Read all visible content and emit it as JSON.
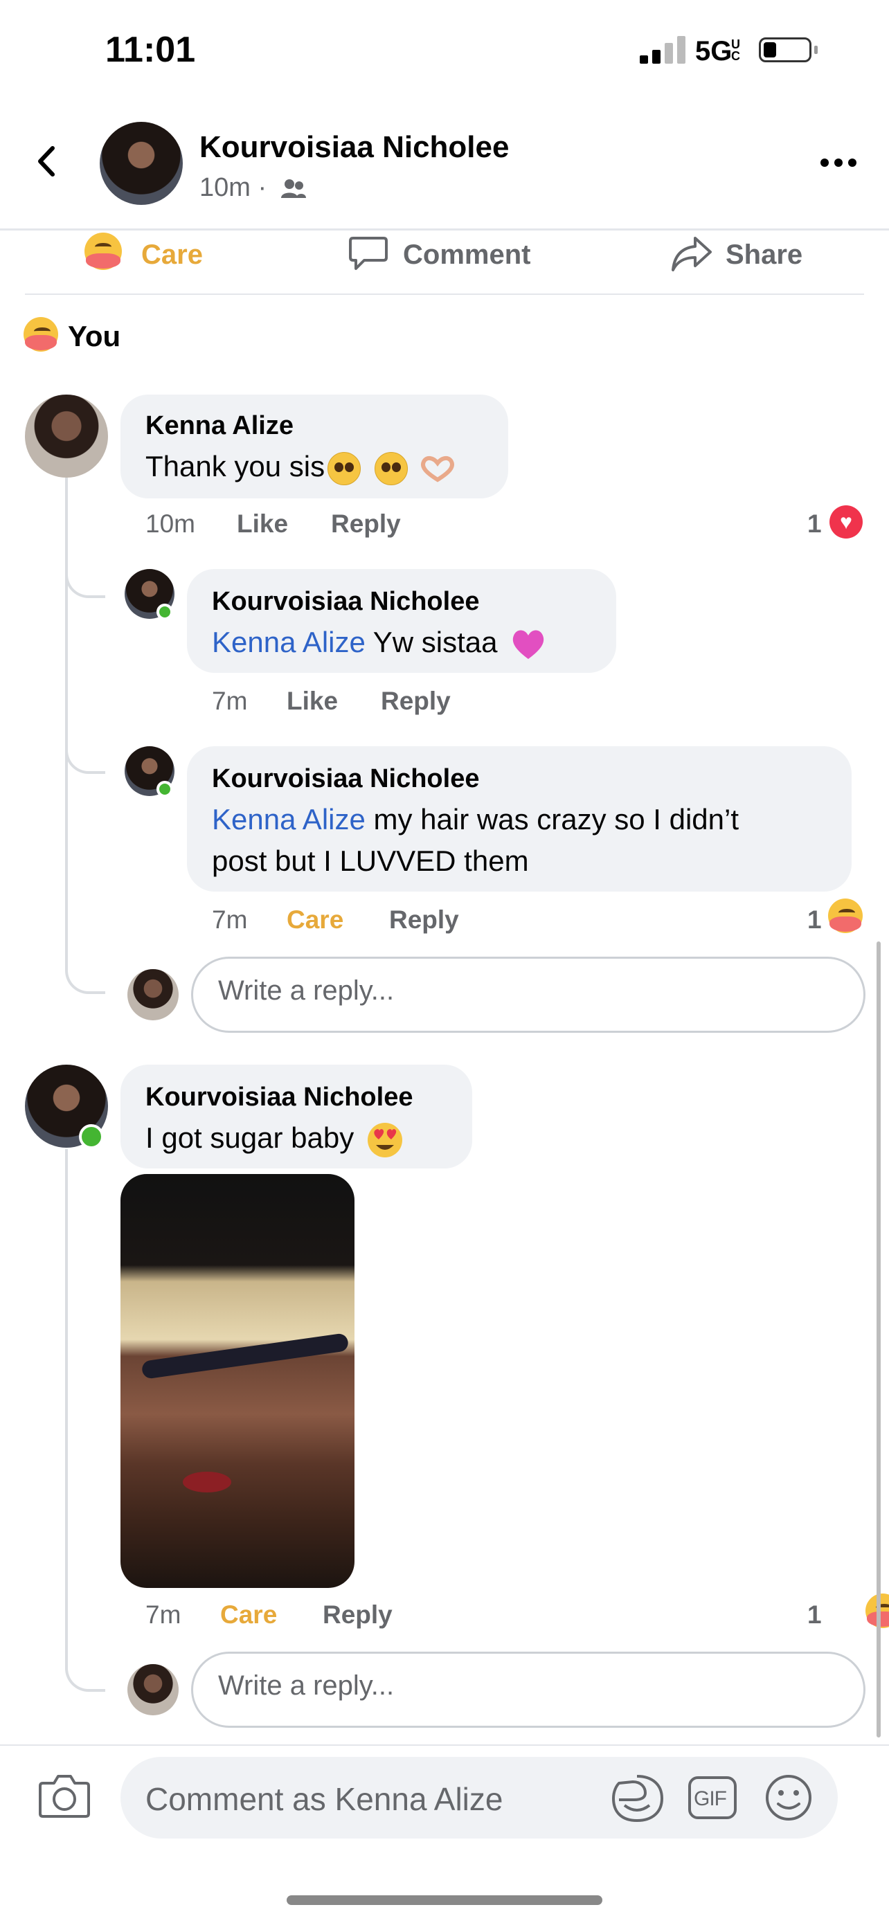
{
  "status_bar": {
    "time": "11:01",
    "network": "5G",
    "network_suffix": "UC"
  },
  "header": {
    "name": "Kourvoisiaa Nicholee",
    "time": "10m ·"
  },
  "actions": {
    "care": "Care",
    "comment": "Comment",
    "share": "Share"
  },
  "reactions": {
    "label": "You"
  },
  "comments": [
    {
      "author": "Kenna Alize",
      "text": "Thank you sis",
      "time": "10m",
      "like": "Like",
      "reply": "Reply",
      "count": "1",
      "replies": [
        {
          "author": "Kourvoisiaa Nicholee",
          "mention": "Kenna Alize",
          "text": "Yw sistaa",
          "time": "7m",
          "like": "Like",
          "reply": "Reply"
        },
        {
          "author": "Kourvoisiaa Nicholee",
          "mention": "Kenna Alize",
          "text": "my hair was crazy so I didn’t",
          "text2": "post but I LUVVED them",
          "time": "7m",
          "care": "Care",
          "reply": "Reply",
          "count": "1"
        }
      ],
      "write_reply": "Write a reply..."
    },
    {
      "author": "Kourvoisiaa Nicholee",
      "text": "I got sugar baby",
      "time": "7m",
      "care": "Care",
      "reply": "Reply",
      "count": "1",
      "write_reply": "Write a reply..."
    }
  ],
  "composer": {
    "placeholder": "Comment as Kenna Alize",
    "gif": "GIF"
  },
  "colors": {
    "care": "#e7a93a",
    "mention": "#2e63c8",
    "online": "#44b532",
    "heart": "#f0334c"
  }
}
